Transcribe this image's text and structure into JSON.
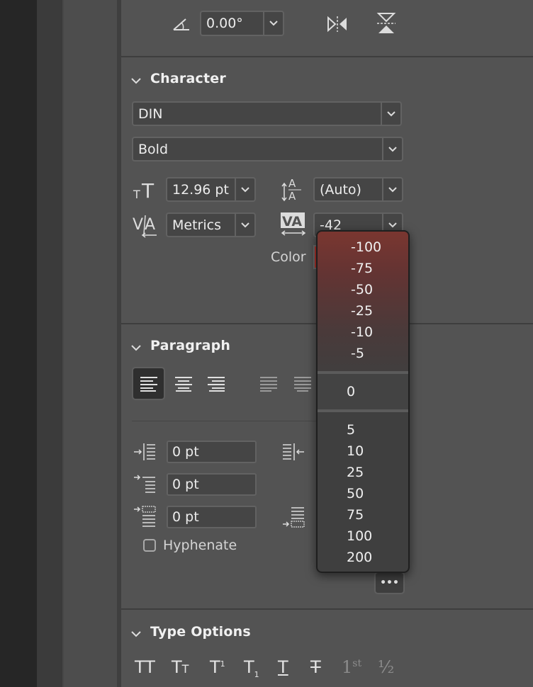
{
  "top_toolbar": {
    "angle_value": "0.00°"
  },
  "character": {
    "title": "Character",
    "font_family": "DIN",
    "font_style": "Bold",
    "font_size": "12.96 pt",
    "leading": "(Auto)",
    "kerning": "Metrics",
    "tracking": "-42",
    "color_label": "Color",
    "color_swatch": "#b0302a"
  },
  "tracking_menu": {
    "group1": [
      "-100",
      "-75",
      "-50",
      "-25",
      "-10",
      "-5"
    ],
    "zero": "0",
    "group2": [
      "5",
      "10",
      "25",
      "50",
      "75",
      "100",
      "200"
    ]
  },
  "paragraph": {
    "title": "Paragraph",
    "indent_left": "0 pt",
    "indent_first_line": "0 pt",
    "space_before": "0 pt",
    "hyphenate_label": "Hyphenate",
    "hyphenate_checked": false
  },
  "more_button_label": "•••",
  "type_options": {
    "title": "Type Options",
    "buttons": [
      "TT",
      "Tt",
      "T¹",
      "T₁",
      "T",
      "T",
      "1st",
      "½"
    ]
  },
  "icons": {
    "angle": "angle-icon",
    "flip_horizontal": "flip-horizontal-icon",
    "flip_vertical": "flip-vertical-icon",
    "font_size": "font-size-icon",
    "leading": "leading-icon",
    "kerning": "kerning-icon",
    "tracking": "tracking-icon"
  }
}
